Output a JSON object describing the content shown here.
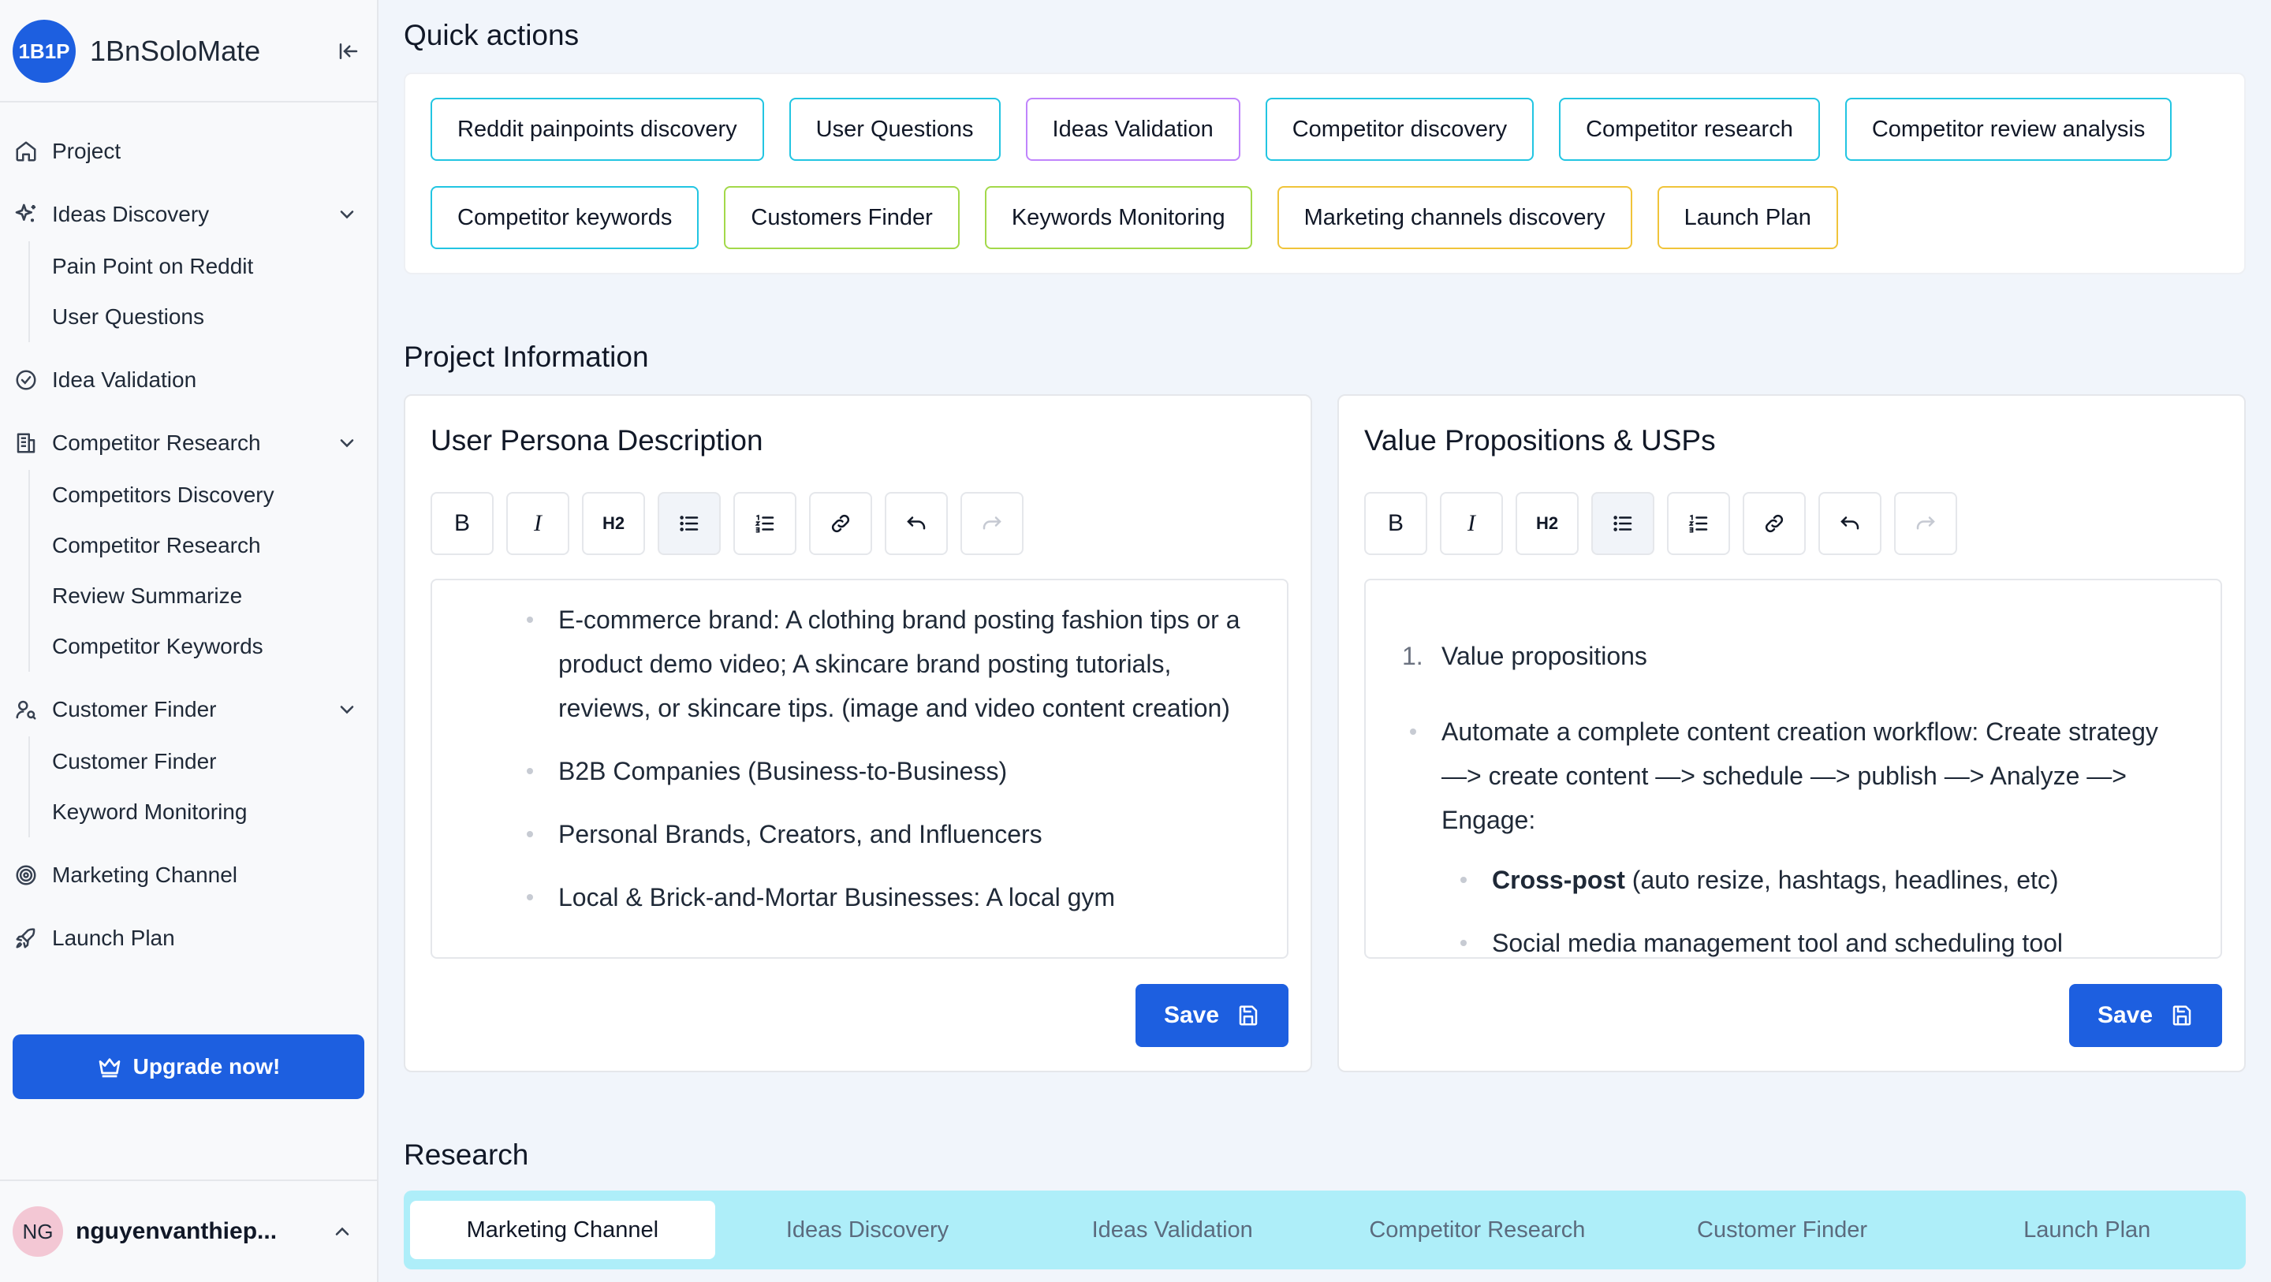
{
  "sidebar": {
    "logo": "1B1P",
    "app_name": "1BnSoloMate",
    "nav": [
      {
        "label": "Project"
      },
      {
        "label": "Ideas Discovery",
        "children": [
          "Pain Point on Reddit",
          "User Questions"
        ]
      },
      {
        "label": "Idea Validation"
      },
      {
        "label": "Competitor Research",
        "children": [
          "Competitors Discovery",
          "Competitor Research",
          "Review Summarize",
          "Competitor Keywords"
        ]
      },
      {
        "label": "Customer Finder",
        "children": [
          "Customer Finder",
          "Keyword Monitoring"
        ]
      },
      {
        "label": "Marketing Channel"
      },
      {
        "label": "Launch Plan"
      }
    ],
    "upgrade_label": "Upgrade now!",
    "user": {
      "initials": "NG",
      "name": "nguyenvanthiep..."
    }
  },
  "quick_actions": {
    "title": "Quick actions",
    "row1": [
      "Reddit painpoints discovery",
      "User Questions",
      "Ideas Validation",
      "Competitor discovery",
      "Competitor research",
      "Competitor review analysis"
    ],
    "row2": [
      "Competitor keywords",
      "Customers Finder",
      "Keywords Monitoring",
      "Marketing channels discovery",
      "Launch Plan"
    ]
  },
  "project_info": {
    "title": "Project Information",
    "persona": {
      "title": "User Persona Description",
      "items": [
        "E-commerce brand: A clothing brand posting fashion tips or a product demo video; A skincare brand posting tutorials, reviews, or skincare tips. (image and video content creation)",
        "B2B Companies (Business-to-Business)",
        "Personal Brands, Creators, and Influencers",
        "Local & Brick-and-Mortar Businesses: A local gym"
      ],
      "save_label": "Save"
    },
    "value_props": {
      "title": "Value Propositions & USPs",
      "numbered_marker": "1.",
      "numbered_item": "Value propositions",
      "bullet": "Automate a complete content creation workflow: Create strategy —> create content —> schedule —> publish —> Analyze —> Engage:",
      "sub_bold": "Cross-post",
      "sub_rest": " (auto resize, hashtags, headlines, etc)",
      "sub_2": "Social media management tool and scheduling tool",
      "save_label": "Save"
    },
    "toolbar": {
      "bold": "B",
      "italic": "I",
      "heading": "H2"
    }
  },
  "research": {
    "title": "Research",
    "tabs": [
      "Marketing Channel",
      "Ideas Discovery",
      "Ideas Validation",
      "Competitor Research",
      "Customer Finder",
      "Launch Plan"
    ],
    "active_tab": "Marketing Channel"
  }
}
